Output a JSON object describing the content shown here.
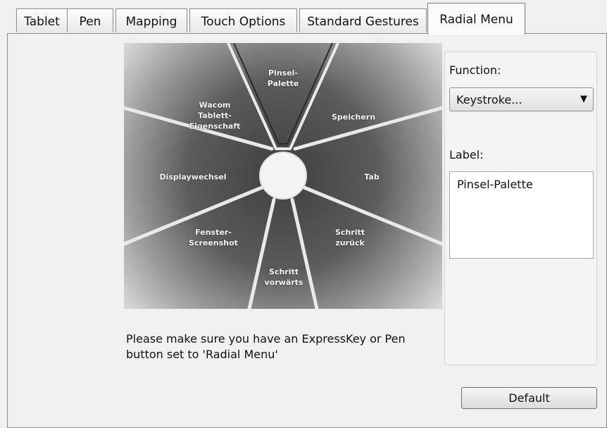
{
  "tabs": [
    {
      "label": "Tablet",
      "active": false
    },
    {
      "label": "Pen",
      "active": false
    },
    {
      "label": "Mapping",
      "active": false
    },
    {
      "label": "Touch Options",
      "active": false
    },
    {
      "label": "Standard Gestures",
      "active": false
    },
    {
      "label": "Radial Menu",
      "active": true
    }
  ],
  "radial_menu": {
    "segments": [
      {
        "label": "Pinsel-\nPalette",
        "selected": true
      },
      {
        "label": "Speichern"
      },
      {
        "label": "Tab"
      },
      {
        "label": "Schritt\nzurück"
      },
      {
        "label": "Schritt\nvorwärts"
      },
      {
        "label": "Fenster-\nScreenshot"
      },
      {
        "label": "Displaywechsel"
      },
      {
        "label": "Wacom\nTablett-\nEigenschaft"
      }
    ]
  },
  "instruction_text": "Please make sure you have an ExpressKey or Pen\nbutton set to 'Radial Menu'",
  "function": {
    "label": "Function:",
    "value": "Keystroke..."
  },
  "label_field": {
    "label": "Label:",
    "value": "Pinsel-Palette"
  },
  "default_button": "Default",
  "icons": {
    "dropdown": "triangle-down-icon"
  },
  "colors": {
    "window_bg": "#f0f0f0",
    "radial_bg": "#5a5a5a",
    "divider": "#e6e6e6"
  }
}
